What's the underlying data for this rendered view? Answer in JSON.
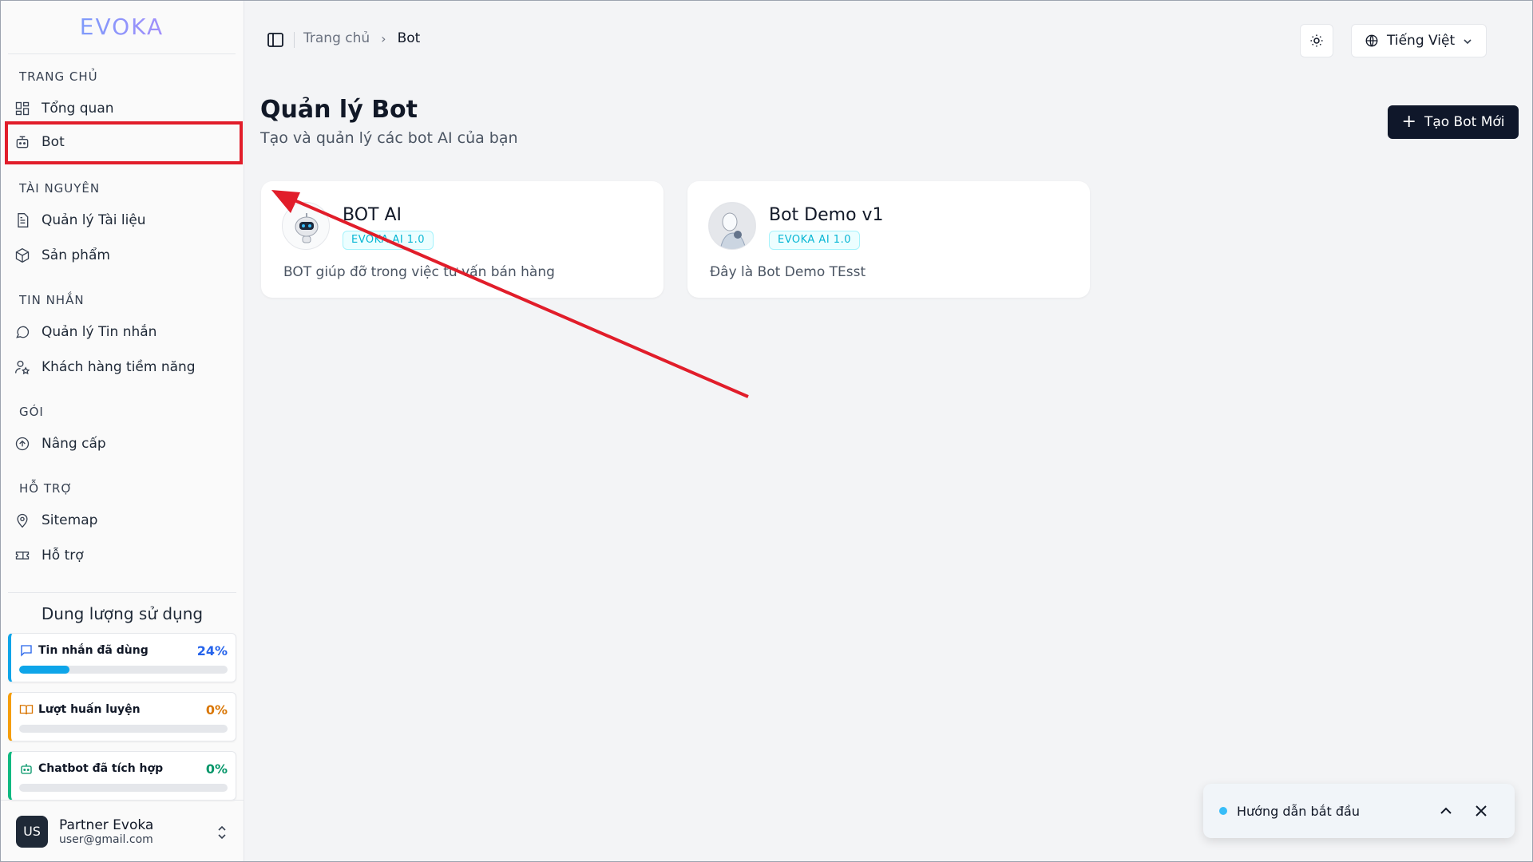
{
  "app": {
    "logo": "EVOKA"
  },
  "sidebar": {
    "sections": [
      {
        "title": "TRANG CHỦ",
        "items": [
          {
            "label": "Tổng quan",
            "icon": "grid-icon"
          },
          {
            "label": "Bot",
            "icon": "bot-icon"
          }
        ]
      },
      {
        "title": "TÀI NGUYÊN",
        "items": [
          {
            "label": "Quản lý Tài liệu",
            "icon": "document-icon"
          },
          {
            "label": "Sản phẩm",
            "icon": "box-icon"
          }
        ]
      },
      {
        "title": "TIN NHẮN",
        "items": [
          {
            "label": "Quản lý Tin nhắn",
            "icon": "chat-icon"
          },
          {
            "label": "Khách hàng tiềm năng",
            "icon": "users-star-icon"
          }
        ]
      },
      {
        "title": "GÓI",
        "items": [
          {
            "label": "Nâng cấp",
            "icon": "arrow-up-circle-icon"
          }
        ]
      },
      {
        "title": "HỖ TRỢ",
        "items": [
          {
            "label": "Sitemap",
            "icon": "map-pin-icon"
          },
          {
            "label": "Hỗ trợ",
            "icon": "ticket-icon"
          }
        ]
      }
    ],
    "usage": {
      "title": "Dung lượng sử dụng",
      "items": [
        {
          "label": "Tin nhắn đã dùng",
          "percent": "24%",
          "value": 24,
          "color": "#2563eb"
        },
        {
          "label": "Lượt huấn luyện",
          "percent": "0%",
          "value": 0,
          "color": "#d97706"
        },
        {
          "label": "Chatbot đã tích hợp",
          "percent": "0%",
          "value": 0,
          "color": "#059669"
        }
      ]
    },
    "user": {
      "initials": "US",
      "name": "Partner Evoka",
      "email": "user@gmail.com"
    }
  },
  "header": {
    "breadcrumb": {
      "home": "Trang chủ",
      "current": "Bot"
    },
    "language": "Tiếng Việt"
  },
  "main": {
    "title": "Quản lý Bot",
    "subtitle": "Tạo và quản lý các bot AI của bạn",
    "create_button": "Tạo Bot Mới",
    "bots": [
      {
        "name": "BOT AI",
        "badge": "EVOKA AI 1.0",
        "description": "BOT giúp đỡ trong việc tư vấn bán hàng"
      },
      {
        "name": "Bot Demo v1",
        "badge": "EVOKA AI 1.0",
        "description": "Đây là Bot Demo TEsst"
      }
    ]
  },
  "guide": {
    "label": "Hướng dẫn bắt đầu"
  },
  "colors": {
    "accent": "#0ea5e9",
    "annotation": "#e11d2a",
    "primary_button": "#0f172a"
  }
}
